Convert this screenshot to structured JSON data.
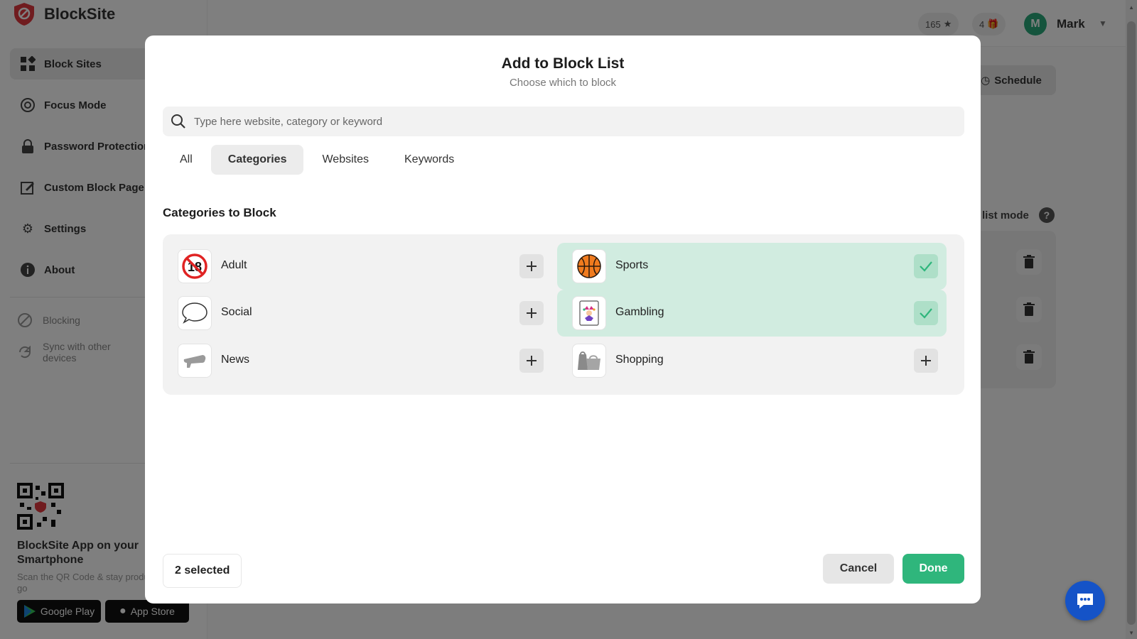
{
  "app": {
    "brand": "BlockSite",
    "nav": [
      {
        "label": "Block Sites",
        "icon": "grid-icon"
      },
      {
        "label": "Focus Mode",
        "icon": "target-icon"
      },
      {
        "label": "Password Protection",
        "icon": "lock-icon"
      },
      {
        "label": "Custom Block Page",
        "icon": "edit-page-icon"
      },
      {
        "label": "Settings",
        "icon": "gear-icon"
      },
      {
        "label": "About",
        "icon": "info-icon"
      }
    ],
    "sub_nav": [
      {
        "label": "Blocking",
        "icon": "block-icon"
      },
      {
        "label": "Sync with other devices",
        "icon": "sync-icon"
      }
    ],
    "promo": {
      "title": "BlockSite App on your Smartphone",
      "subtitle": "Scan the QR Code & stay productive on the go",
      "google_play": "Google Play",
      "app_store": "App Store"
    },
    "header": {
      "points": "165",
      "gifts": "4",
      "avatar_letter": "M",
      "user_name": "Mark"
    },
    "schedule_label": "Schedule",
    "mode_label": "list mode",
    "help_label": "?"
  },
  "modal": {
    "title": "Add to Block List",
    "subtitle": "Choose which to block",
    "search_placeholder": "Type here website, category or keyword",
    "tabs": [
      "All",
      "Categories",
      "Websites",
      "Keywords"
    ],
    "active_tab": "Categories",
    "section_title": "Categories to Block",
    "categories": [
      {
        "label": "Adult",
        "icon": "adult-18-icon",
        "selected": false
      },
      {
        "label": "Sports",
        "icon": "basketball-icon",
        "selected": true
      },
      {
        "label": "Social",
        "icon": "speech-bubble-icon",
        "selected": false
      },
      {
        "label": "Gambling",
        "icon": "joker-card-icon",
        "selected": true
      },
      {
        "label": "News",
        "icon": "megaphone-icon",
        "selected": false
      },
      {
        "label": "Shopping",
        "icon": "shopping-bags-icon",
        "selected": false
      }
    ],
    "selected_count": "2 selected",
    "cancel_label": "Cancel",
    "done_label": "Done"
  },
  "colors": {
    "accent_green": "#2fb67c",
    "selected_bg": "#d1ece0",
    "chat_blue": "#1553c7",
    "brand_red": "#e0383e"
  }
}
